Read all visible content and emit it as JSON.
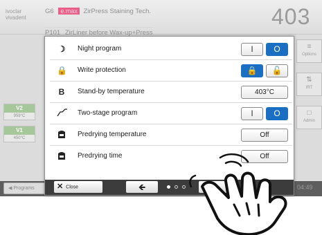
{
  "header": {
    "logo_line1": "ivoclar",
    "logo_line2": "vivadent",
    "device": "G6",
    "badge": "e.max",
    "program_name": "ZirPress Staining Tech.",
    "program_number": "P101",
    "program_subtitle": "ZirLiner before Wax-up+Press",
    "temperature": "403"
  },
  "left_panel": {
    "v2_label": "V2",
    "v2_temp": "959°C",
    "v1_label": "V1",
    "v1_temp": "450°C",
    "programs_label": "Programs"
  },
  "right_panel": {
    "options_label": "Options",
    "irt_label": "IRT",
    "admin_label": "Admin"
  },
  "settings": [
    {
      "icon": "moon-icon",
      "label": "Night program",
      "control": "toggle",
      "state": "off"
    },
    {
      "icon": "lock-icon",
      "label": "Write protection",
      "control": "lock",
      "state": "locked"
    },
    {
      "icon": "standby-icon",
      "glyph": "B",
      "label": "Stand-by temperature",
      "control": "value",
      "value": "403°C"
    },
    {
      "icon": "two-stage-curve-icon",
      "label": "Two-stage program",
      "control": "toggle",
      "state": "off"
    },
    {
      "icon": "predry-icon",
      "label": "Predrying temperature",
      "control": "value",
      "value": "Off"
    },
    {
      "icon": "predry-time-icon",
      "label": "Predrying time",
      "control": "value",
      "value": "Off"
    }
  ],
  "toggle_glyphs": {
    "on": "I",
    "off": "O"
  },
  "footer": {
    "close_label": "Close",
    "page_current": 1,
    "page_total": 3
  },
  "time": "04:49",
  "colors": {
    "active_blue": "#1a6fc2",
    "badge_pink": "#e95f87",
    "v_green": "#a6c79a"
  }
}
